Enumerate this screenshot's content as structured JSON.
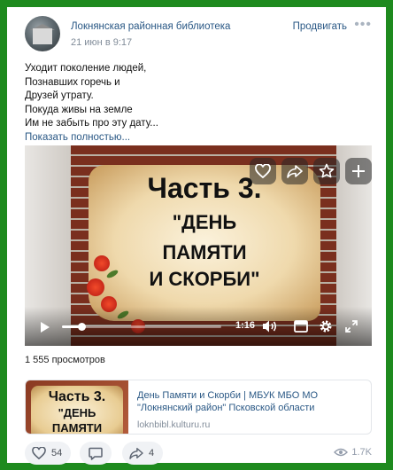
{
  "post": {
    "author": "Локнянская районная библиотека",
    "date": "21 июн в 9:17",
    "promote_label": "Продвигать",
    "more_label": "•••",
    "text_lines": [
      "Уходит поколение людей,",
      "Познавших горечь и",
      "Друзей утрату.",
      "Покуда живы на земле",
      "Им не забыть про эту дату..."
    ],
    "show_more": "Показать полностью..."
  },
  "video": {
    "title_line1": "Часть 3.",
    "title_line2": "\"ДЕНЬ",
    "title_line3": "ПАМЯТИ",
    "title_line4": "И СКОРБИ\"",
    "time": "1:16",
    "progress": 0.12,
    "views": "1 555 просмотров"
  },
  "link": {
    "thumb_line1": "Часть 3.",
    "thumb_line2": "\"ДЕНЬ",
    "thumb_line3": "ПАМЯТИ",
    "title": "День Памяти и Скорби | МБУК МБО МО \"Локнянский район\" Псковской области",
    "domain": "loknbibl.kulturu.ru"
  },
  "actions": {
    "likes": "54",
    "shares": "4",
    "views": "1.7K"
  },
  "colors": {
    "frame": "#1e8a1e",
    "link": "#2a5885",
    "muted": "#818c99"
  }
}
